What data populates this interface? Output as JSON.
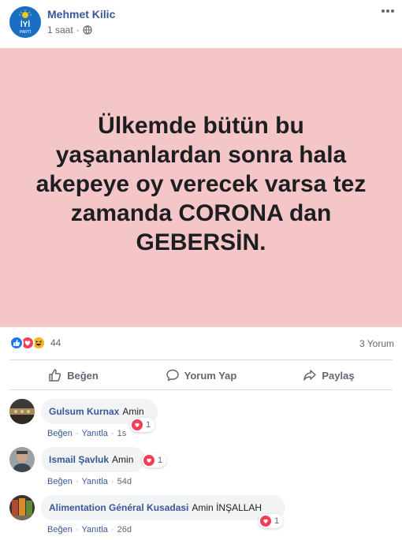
{
  "header": {
    "author": "Mehmet Kilic",
    "time": "1 saat",
    "separator": "·",
    "avatar_text": "İYİ",
    "avatar_subtext": "PARTİ"
  },
  "post": {
    "background": "#f5c6c7",
    "text": "Ülkemde bütün bu yaşananlardan sonra hala akepeye oy verecek varsa tez zamanda CORONA dan GEBERSİN."
  },
  "reactions": {
    "types": [
      "like-icon",
      "love-icon",
      "haha-icon"
    ],
    "count": "44",
    "comments_count": "3 Yorum"
  },
  "actions": {
    "like": "Beğen",
    "comment": "Yorum Yap",
    "share": "Paylaş"
  },
  "comments": [
    {
      "name": "Gulsum Kurnax",
      "text": "Amin",
      "like": "Beğen",
      "reply": "Yanıtla",
      "time": "1s",
      "reaction_count": "1"
    },
    {
      "name": "Ismail Şavluk",
      "text": "Amin",
      "like": "Beğen",
      "reply": "Yanıtla",
      "time": "54d",
      "reaction_count": "1"
    },
    {
      "name": "Alimentation Général Kusadasi",
      "text": "Amin İNŞALLAH",
      "like": "Beğen",
      "reply": "Yanıtla",
      "time": "26d",
      "reaction_count": "1"
    }
  ],
  "colors": {
    "link": "#385898",
    "like_blue": "#1877f2",
    "love_red": "#f33e58",
    "haha_yellow": "#f7b125"
  }
}
